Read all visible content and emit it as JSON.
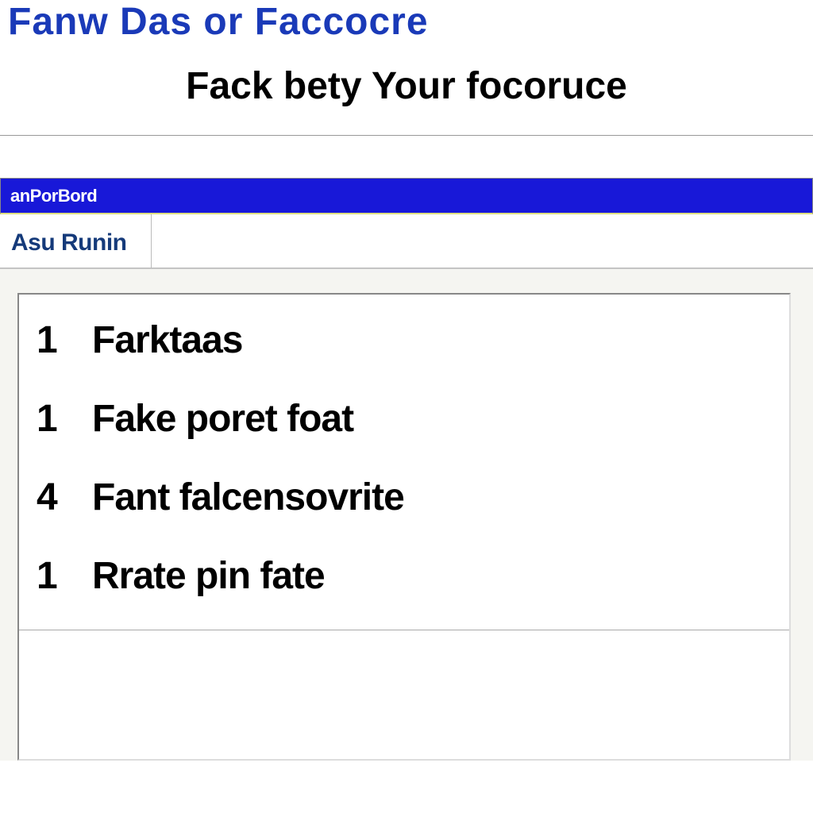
{
  "header": {
    "title_top": "Fanw Das or Faccocre",
    "title_sub": "Fack bety Your focoruce"
  },
  "toolbar": {
    "selection_text": "anPorBord"
  },
  "tabs": [
    {
      "label": "Asu Runin"
    }
  ],
  "list": {
    "rows": [
      {
        "num": "1",
        "text": "Farktaas"
      },
      {
        "num": "1",
        "text": "Fake poret foat"
      },
      {
        "num": "4",
        "text": "Fant falcensovrite"
      },
      {
        "num": "1",
        "text": "Rrate pin fate"
      }
    ]
  }
}
